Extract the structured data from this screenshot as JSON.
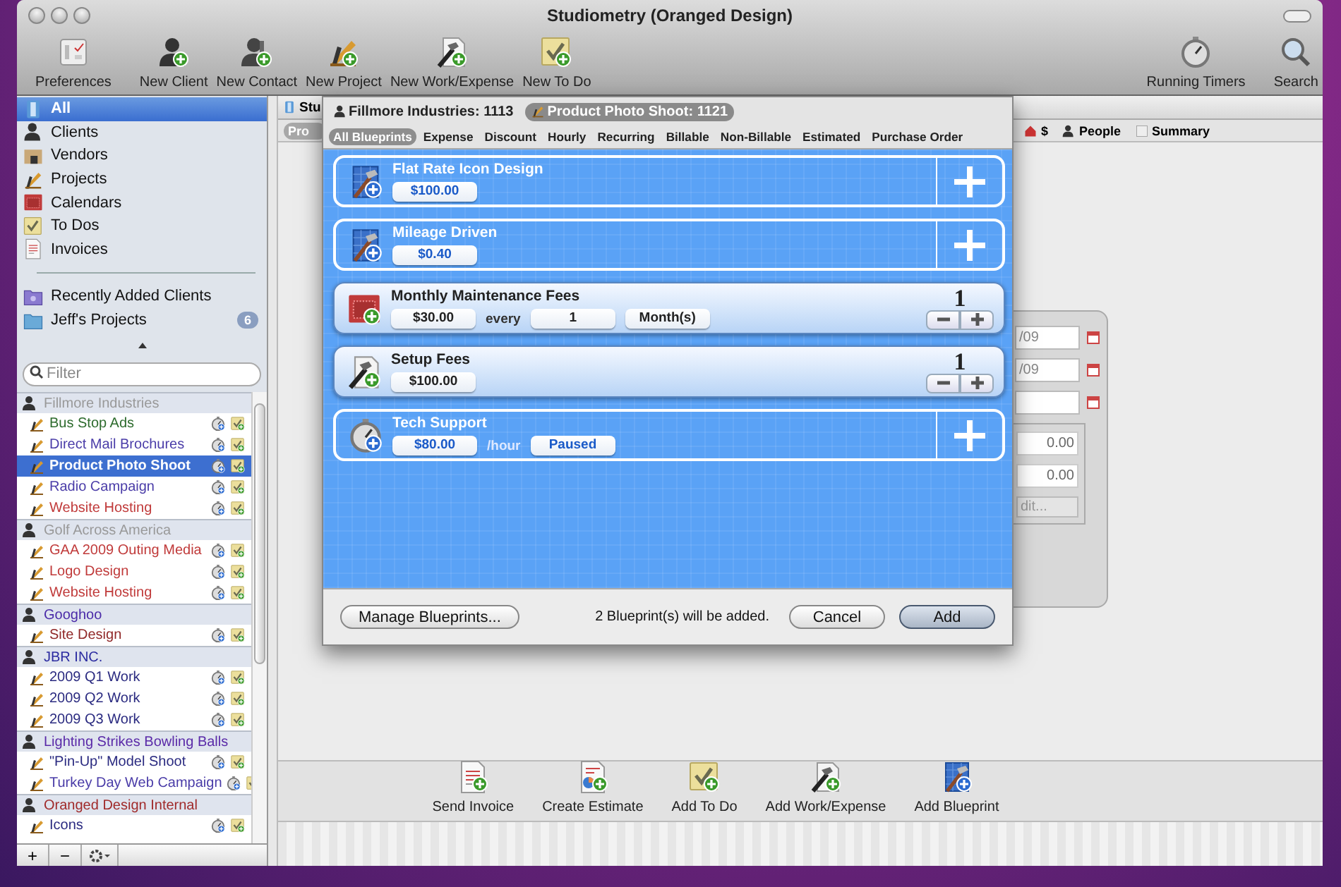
{
  "window": {
    "title": "Studiometry (Oranged Design)"
  },
  "toolbar": {
    "left": [
      {
        "label": "Preferences",
        "kind": "preferences"
      },
      {
        "label": "New Client",
        "kind": "person"
      },
      {
        "label": "New Contact",
        "kind": "contact"
      },
      {
        "label": "New Project",
        "kind": "project"
      },
      {
        "label": "New Work/Expense",
        "kind": "work"
      },
      {
        "label": "New To Do",
        "kind": "todo"
      }
    ],
    "right": [
      {
        "label": "Running Timers",
        "kind": "timer"
      },
      {
        "label": "Search",
        "kind": "search"
      }
    ]
  },
  "sidebar": {
    "sources": [
      {
        "label": "All",
        "kind": "all",
        "selected": true
      },
      {
        "label": "Clients",
        "kind": "person",
        "selected": false
      },
      {
        "label": "Vendors",
        "kind": "vendor",
        "selected": false
      },
      {
        "label": "Projects",
        "kind": "project",
        "selected": false
      },
      {
        "label": "Calendars",
        "kind": "calendar",
        "selected": false
      },
      {
        "label": "To Dos",
        "kind": "todo",
        "selected": false
      },
      {
        "label": "Invoices",
        "kind": "invoice",
        "selected": false
      }
    ],
    "groups": [
      {
        "label": "Recently Added Clients",
        "kind": "smartfolder"
      },
      {
        "label": "Jeff's Projects",
        "kind": "folder",
        "badge": "6"
      }
    ],
    "filter": {
      "placeholder": "Filter"
    },
    "clients": [
      {
        "name": "Fillmore Industries",
        "color": "#999999",
        "children": [
          {
            "name": "Bus Stop Ads",
            "color": "#2d6b2d",
            "selected": false
          },
          {
            "name": "Direct Mail Brochures",
            "color": "#4a3ca8",
            "selected": false
          },
          {
            "name": "Product Photo Shoot",
            "color": "#ffffff",
            "selected": true
          },
          {
            "name": "Radio Campaign",
            "color": "#4a3ca8",
            "selected": false
          },
          {
            "name": "Website Hosting",
            "color": "#c03a3a",
            "selected": false
          }
        ]
      },
      {
        "name": "Golf Across America",
        "color": "#999999",
        "children": [
          {
            "name": "GAA 2009 Outing Media",
            "color": "#c03a3a",
            "selected": false
          },
          {
            "name": "Logo Design",
            "color": "#c03a3a",
            "selected": false
          },
          {
            "name": "Website Hosting",
            "color": "#c03a3a",
            "selected": false
          }
        ]
      },
      {
        "name": "Googhoo",
        "color": "#4a2aa8",
        "children": [
          {
            "name": "Site Design",
            "color": "#902828",
            "selected": false
          }
        ]
      },
      {
        "name": "JBR INC.",
        "color": "#2a2aa0",
        "children": [
          {
            "name": "2009 Q1 Work",
            "color": "#2a2a80",
            "selected": false
          },
          {
            "name": "2009 Q2 Work",
            "color": "#2a2a80",
            "selected": false
          },
          {
            "name": "2009 Q3 Work",
            "color": "#2a2a80",
            "selected": false
          }
        ]
      },
      {
        "name": "Lighting Strikes Bowling Balls",
        "color": "#5a2aa8",
        "children": [
          {
            "name": "\"Pin-Up\" Model Shoot",
            "color": "#2a2a80",
            "selected": false
          },
          {
            "name": "Turkey Day Web Campaign",
            "color": "#4a3ca8",
            "selected": false
          }
        ]
      },
      {
        "name": "Oranged Design Internal",
        "color": "#a02a2a",
        "children": [
          {
            "name": "Icons",
            "color": "#2a2a80",
            "selected": false
          }
        ]
      }
    ],
    "bottom_buttons": [
      "+",
      "−"
    ]
  },
  "main": {
    "tabs": [
      "Stu"
    ],
    "subtabs": [
      "Pro"
    ],
    "views": [
      {
        "label": "$",
        "kind": "money"
      },
      {
        "label": "People",
        "kind": "person"
      },
      {
        "label": "Summary",
        "kind": "summary"
      }
    ],
    "form": {
      "dates": [
        "/09",
        "/09"
      ],
      "amounts": [
        "0.00",
        "0.00"
      ],
      "edit_button": "dit..."
    },
    "actions": [
      {
        "label": "Send Invoice",
        "kind": "invoice"
      },
      {
        "label": "Create Estimate",
        "kind": "estimate"
      },
      {
        "label": "Add To Do",
        "kind": "todo"
      },
      {
        "label": "Add Work/Expense",
        "kind": "work"
      },
      {
        "label": "Add Blueprint",
        "kind": "blueprint"
      }
    ]
  },
  "dialog": {
    "client": "Fillmore Industries: 1113",
    "project": "Product Photo Shoot: 1121",
    "filters": [
      {
        "label": "All Blueprints",
        "selected": true
      },
      {
        "label": "Expense",
        "selected": false
      },
      {
        "label": "Discount",
        "selected": false
      },
      {
        "label": "Hourly",
        "selected": false
      },
      {
        "label": "Recurring",
        "selected": false
      },
      {
        "label": "Billable",
        "selected": false
      },
      {
        "label": "Non-Billable",
        "selected": false
      },
      {
        "label": "Estimated",
        "selected": false
      },
      {
        "label": "Purchase Order",
        "selected": false
      }
    ],
    "blueprints": [
      {
        "title": "Flat Rate Icon Design",
        "kind": "blueprint",
        "selected": false,
        "fields": [
          {
            "kind": "field",
            "text": "$100.00"
          }
        ]
      },
      {
        "title": "Mileage Driven",
        "kind": "blueprint",
        "selected": false,
        "fields": [
          {
            "kind": "field",
            "text": "$0.40"
          }
        ]
      },
      {
        "title": "Monthly Maintenance Fees",
        "kind": "calendar",
        "selected": true,
        "count": "1",
        "fields": [
          {
            "kind": "field",
            "text": "$30.00"
          },
          {
            "kind": "label",
            "text": "every"
          },
          {
            "kind": "field",
            "text": "1"
          },
          {
            "kind": "field",
            "text": "Month(s)"
          }
        ]
      },
      {
        "title": "Setup Fees",
        "kind": "work",
        "selected": true,
        "count": "1",
        "fields": [
          {
            "kind": "field",
            "text": "$100.00"
          }
        ]
      },
      {
        "title": "Tech Support",
        "kind": "timer",
        "selected": false,
        "fields": [
          {
            "kind": "field",
            "text": "$80.00"
          },
          {
            "kind": "label",
            "text": "/hour"
          },
          {
            "kind": "field",
            "text": "Paused"
          }
        ]
      }
    ],
    "manage_button": "Manage Blueprints...",
    "status": "2 Blueprint(s) will be added.",
    "buttons": [
      {
        "label": "Cancel",
        "default": false
      },
      {
        "label": "Add",
        "default": true
      }
    ]
  }
}
